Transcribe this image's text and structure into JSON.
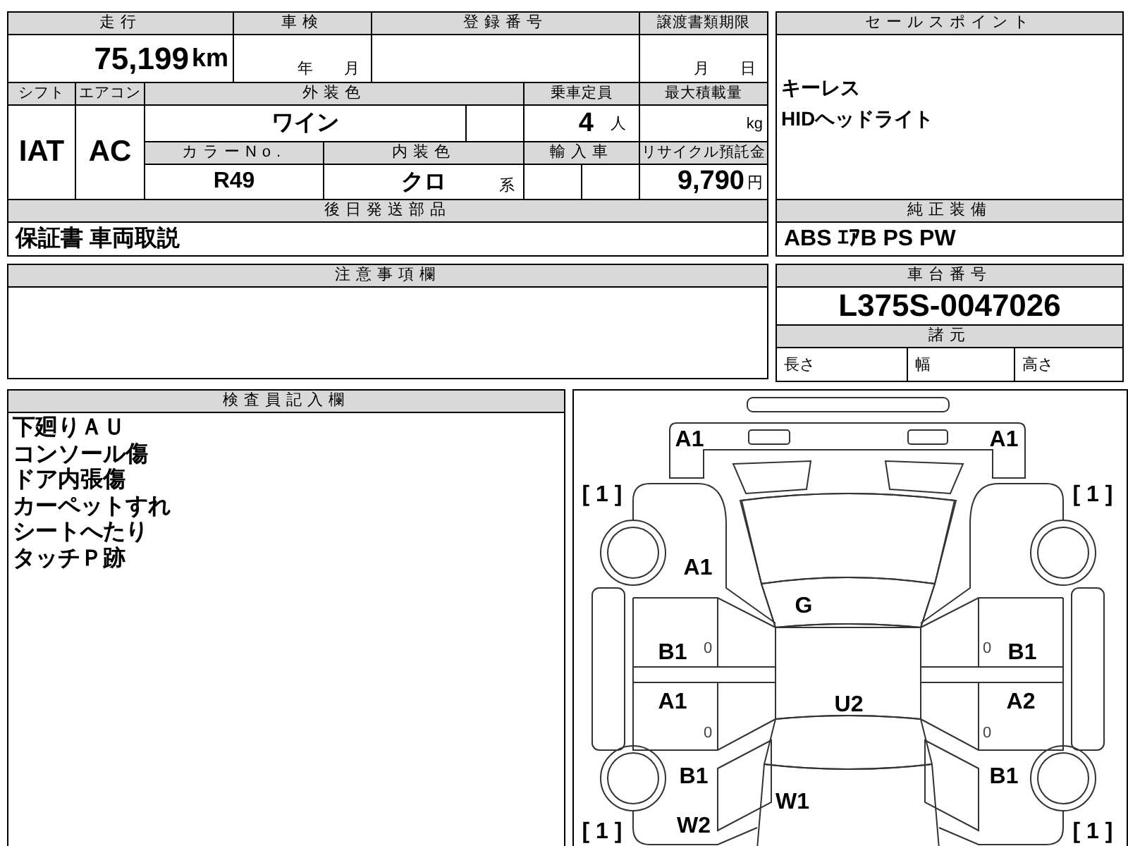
{
  "sheet": {
    "mileage": {
      "label": "走行",
      "value": "75,199",
      "unit": "km"
    },
    "inspection": {
      "label": "車検",
      "year_unit": "年",
      "month_unit": "月"
    },
    "registration_number": {
      "label": "登録番号"
    },
    "transfer_deadline": {
      "label": "譲渡書類期限",
      "month_unit": "月",
      "day_unit": "日"
    },
    "shift": {
      "label": "シフト",
      "value": "IAT"
    },
    "aircon": {
      "label": "エアコン",
      "value": "AC"
    },
    "exterior_color": {
      "label": "外装色",
      "value": "ワイン"
    },
    "capacity": {
      "label": "乗車定員",
      "value": "4",
      "unit": "人"
    },
    "max_load": {
      "label": "最大積載量",
      "unit": "kg"
    },
    "color_no": {
      "label": "カラーNo.",
      "value": "R49"
    },
    "interior_color": {
      "label": "内装色",
      "value": "クロ",
      "suffix": "系"
    },
    "imported": {
      "label": "輸入車"
    },
    "recycle_fee": {
      "label": "リサイクル預託金",
      "value": "9,790",
      "unit": "円"
    },
    "later_parts": {
      "label": "後日発送部品",
      "value": "保証書 車両取説"
    }
  },
  "sales_points": {
    "label": "セールスポイント",
    "items": [
      "キーレス",
      "HIDヘッドライト"
    ]
  },
  "standard_equipment": {
    "label": "純正装備",
    "value": "ABS ｴｱB PS PW"
  },
  "notes": {
    "label": "注意事項欄"
  },
  "chassis": {
    "label": "車台番号",
    "value": "L375S-0047026"
  },
  "specs": {
    "label": "諸元",
    "fields": [
      "長さ",
      "幅",
      "高さ"
    ]
  },
  "inspector_notes": {
    "label": "検査員記入欄",
    "lines": [
      "下廻りＡＵ",
      "コンソール傷",
      "ドア内張傷",
      "カーペットすれ",
      "シートへたり",
      "タッチＰ跡"
    ]
  },
  "diagram": {
    "front_bumper_left": "A1",
    "front_bumper_right": "A1",
    "tire_front_left": "[ 1 ]",
    "tire_front_right": "[ 1 ]",
    "front_fender_left": "A1",
    "windshield": "G",
    "front_door_left": "B1",
    "front_door_left_note": "0",
    "front_door_right_note": "0",
    "front_door_right": "B1",
    "rear_door_left": "A1",
    "roof": "U2",
    "rear_door_right": "A2",
    "rear_door_left_note": "0",
    "rear_door_right_note": "0",
    "rear_fender_left": "B1",
    "rear_fender_right": "B1",
    "rear_window": "W1",
    "tire_rear_left": "[ 1 ]",
    "rear_quarter_glass_left": "W2",
    "tire_rear_right": "[ 1 ]"
  }
}
